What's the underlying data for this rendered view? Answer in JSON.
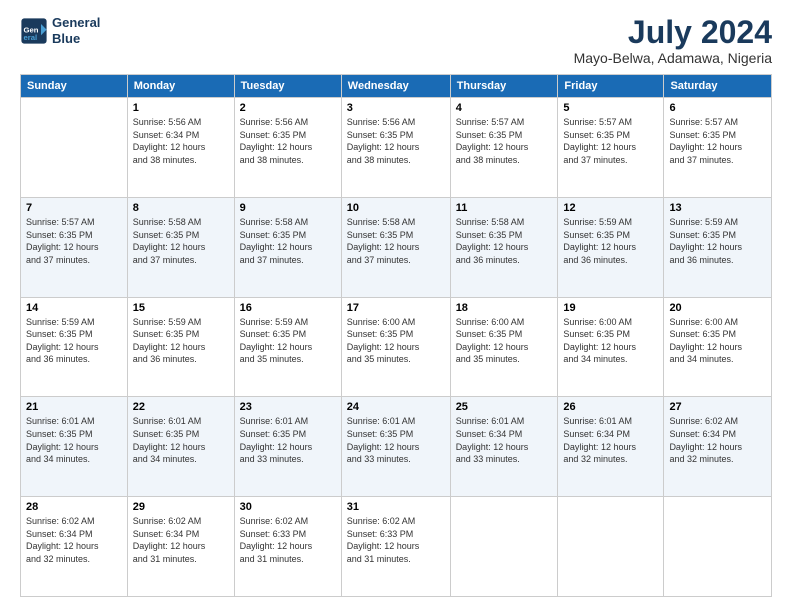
{
  "header": {
    "logo_line1": "General",
    "logo_line2": "Blue",
    "month_title": "July 2024",
    "location": "Mayo-Belwa, Adamawa, Nigeria"
  },
  "weekdays": [
    "Sunday",
    "Monday",
    "Tuesday",
    "Wednesday",
    "Thursday",
    "Friday",
    "Saturday"
  ],
  "weeks": [
    [
      {
        "day": "",
        "info": ""
      },
      {
        "day": "1",
        "info": "Sunrise: 5:56 AM\nSunset: 6:34 PM\nDaylight: 12 hours\nand 38 minutes."
      },
      {
        "day": "2",
        "info": "Sunrise: 5:56 AM\nSunset: 6:35 PM\nDaylight: 12 hours\nand 38 minutes."
      },
      {
        "day": "3",
        "info": "Sunrise: 5:56 AM\nSunset: 6:35 PM\nDaylight: 12 hours\nand 38 minutes."
      },
      {
        "day": "4",
        "info": "Sunrise: 5:57 AM\nSunset: 6:35 PM\nDaylight: 12 hours\nand 38 minutes."
      },
      {
        "day": "5",
        "info": "Sunrise: 5:57 AM\nSunset: 6:35 PM\nDaylight: 12 hours\nand 37 minutes."
      },
      {
        "day": "6",
        "info": "Sunrise: 5:57 AM\nSunset: 6:35 PM\nDaylight: 12 hours\nand 37 minutes."
      }
    ],
    [
      {
        "day": "7",
        "info": "Sunrise: 5:57 AM\nSunset: 6:35 PM\nDaylight: 12 hours\nand 37 minutes."
      },
      {
        "day": "8",
        "info": "Sunrise: 5:58 AM\nSunset: 6:35 PM\nDaylight: 12 hours\nand 37 minutes."
      },
      {
        "day": "9",
        "info": "Sunrise: 5:58 AM\nSunset: 6:35 PM\nDaylight: 12 hours\nand 37 minutes."
      },
      {
        "day": "10",
        "info": "Sunrise: 5:58 AM\nSunset: 6:35 PM\nDaylight: 12 hours\nand 37 minutes."
      },
      {
        "day": "11",
        "info": "Sunrise: 5:58 AM\nSunset: 6:35 PM\nDaylight: 12 hours\nand 36 minutes."
      },
      {
        "day": "12",
        "info": "Sunrise: 5:59 AM\nSunset: 6:35 PM\nDaylight: 12 hours\nand 36 minutes."
      },
      {
        "day": "13",
        "info": "Sunrise: 5:59 AM\nSunset: 6:35 PM\nDaylight: 12 hours\nand 36 minutes."
      }
    ],
    [
      {
        "day": "14",
        "info": "Sunrise: 5:59 AM\nSunset: 6:35 PM\nDaylight: 12 hours\nand 36 minutes."
      },
      {
        "day": "15",
        "info": "Sunrise: 5:59 AM\nSunset: 6:35 PM\nDaylight: 12 hours\nand 36 minutes."
      },
      {
        "day": "16",
        "info": "Sunrise: 5:59 AM\nSunset: 6:35 PM\nDaylight: 12 hours\nand 35 minutes."
      },
      {
        "day": "17",
        "info": "Sunrise: 6:00 AM\nSunset: 6:35 PM\nDaylight: 12 hours\nand 35 minutes."
      },
      {
        "day": "18",
        "info": "Sunrise: 6:00 AM\nSunset: 6:35 PM\nDaylight: 12 hours\nand 35 minutes."
      },
      {
        "day": "19",
        "info": "Sunrise: 6:00 AM\nSunset: 6:35 PM\nDaylight: 12 hours\nand 34 minutes."
      },
      {
        "day": "20",
        "info": "Sunrise: 6:00 AM\nSunset: 6:35 PM\nDaylight: 12 hours\nand 34 minutes."
      }
    ],
    [
      {
        "day": "21",
        "info": "Sunrise: 6:01 AM\nSunset: 6:35 PM\nDaylight: 12 hours\nand 34 minutes."
      },
      {
        "day": "22",
        "info": "Sunrise: 6:01 AM\nSunset: 6:35 PM\nDaylight: 12 hours\nand 34 minutes."
      },
      {
        "day": "23",
        "info": "Sunrise: 6:01 AM\nSunset: 6:35 PM\nDaylight: 12 hours\nand 33 minutes."
      },
      {
        "day": "24",
        "info": "Sunrise: 6:01 AM\nSunset: 6:35 PM\nDaylight: 12 hours\nand 33 minutes."
      },
      {
        "day": "25",
        "info": "Sunrise: 6:01 AM\nSunset: 6:34 PM\nDaylight: 12 hours\nand 33 minutes."
      },
      {
        "day": "26",
        "info": "Sunrise: 6:01 AM\nSunset: 6:34 PM\nDaylight: 12 hours\nand 32 minutes."
      },
      {
        "day": "27",
        "info": "Sunrise: 6:02 AM\nSunset: 6:34 PM\nDaylight: 12 hours\nand 32 minutes."
      }
    ],
    [
      {
        "day": "28",
        "info": "Sunrise: 6:02 AM\nSunset: 6:34 PM\nDaylight: 12 hours\nand 32 minutes."
      },
      {
        "day": "29",
        "info": "Sunrise: 6:02 AM\nSunset: 6:34 PM\nDaylight: 12 hours\nand 31 minutes."
      },
      {
        "day": "30",
        "info": "Sunrise: 6:02 AM\nSunset: 6:33 PM\nDaylight: 12 hours\nand 31 minutes."
      },
      {
        "day": "31",
        "info": "Sunrise: 6:02 AM\nSunset: 6:33 PM\nDaylight: 12 hours\nand 31 minutes."
      },
      {
        "day": "",
        "info": ""
      },
      {
        "day": "",
        "info": ""
      },
      {
        "day": "",
        "info": ""
      }
    ]
  ]
}
